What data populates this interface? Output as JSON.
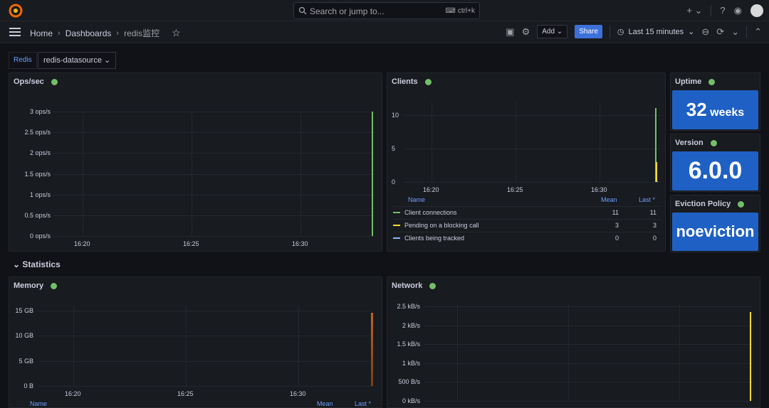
{
  "search": {
    "placeholder": "Search or jump to...",
    "shortcut": "ctrl+k"
  },
  "breadcrumb": {
    "home": "Home",
    "dashboards": "Dashboards",
    "current": "redis监控"
  },
  "toolbar": {
    "add_label": "Add",
    "share_label": "Share",
    "time_range": "Last 15 minutes"
  },
  "variables": {
    "label": "Redis",
    "value": "redis-datasource"
  },
  "panels": {
    "ops": {
      "title": "Ops/sec"
    },
    "clients": {
      "title": "Clients"
    },
    "uptime": {
      "title": "Uptime",
      "value": "32",
      "unit": "weeks"
    },
    "version": {
      "title": "Version",
      "value": "6.0.0"
    },
    "eviction": {
      "title": "Eviction Policy",
      "value": "noeviction"
    },
    "memory": {
      "title": "Memory"
    },
    "network": {
      "title": "Network"
    }
  },
  "row": {
    "statistics": "Statistics"
  },
  "legend": {
    "name_header": "Name",
    "mean_header": "Mean",
    "last_header": "Last *",
    "items": [
      {
        "name": "Client connections",
        "mean": "11",
        "last": "11",
        "color": "#73bf69"
      },
      {
        "name": "Pending on a blocking call",
        "mean": "3",
        "last": "3",
        "color": "#fade2a"
      },
      {
        "name": "Clients being tracked",
        "mean": "0",
        "last": "0",
        "color": "#8ab8ff"
      }
    ]
  },
  "memory_legend": {
    "name_header": "Name",
    "mean_header": "Mean",
    "last_header": "Last *"
  },
  "colors": {
    "accent": "#3d71d9",
    "stat_bg": "#1f60c4",
    "ok": "#73bf69"
  },
  "chart_data": [
    {
      "type": "line",
      "title": "Ops/sec",
      "x": [
        "16:20",
        "16:25",
        "16:30"
      ],
      "y_ticks": [
        "0 ops/s",
        "0.5 ops/s",
        "1 ops/s",
        "1.5 ops/s",
        "2 ops/s",
        "2.5 ops/s",
        "3 ops/s"
      ],
      "ylim": [
        0,
        3
      ],
      "series": [
        {
          "values": [
            3
          ]
        }
      ]
    },
    {
      "type": "line",
      "title": "Clients",
      "x": [
        "16:20",
        "16:25",
        "16:30"
      ],
      "y_ticks": [
        "0",
        "5",
        "10"
      ],
      "ylim": [
        0,
        12
      ],
      "series": [
        {
          "name": "Client connections",
          "values": [
            11
          ]
        },
        {
          "name": "Pending on a blocking call",
          "values": [
            3
          ]
        },
        {
          "name": "Clients being tracked",
          "values": [
            0
          ]
        }
      ]
    },
    {
      "type": "line",
      "title": "Memory",
      "x": [
        "16:20",
        "16:25",
        "16:30"
      ],
      "y_ticks": [
        "0 B",
        "5 GB",
        "10 GB",
        "15 GB"
      ],
      "ylim": [
        0,
        16
      ]
    },
    {
      "type": "line",
      "title": "Network",
      "y_ticks": [
        "0 kB/s",
        "500 B/s",
        "1 kB/s",
        "1.5 kB/s",
        "2 kB/s",
        "2.5 kB/s"
      ],
      "ylim": [
        0,
        2.6
      ]
    }
  ]
}
